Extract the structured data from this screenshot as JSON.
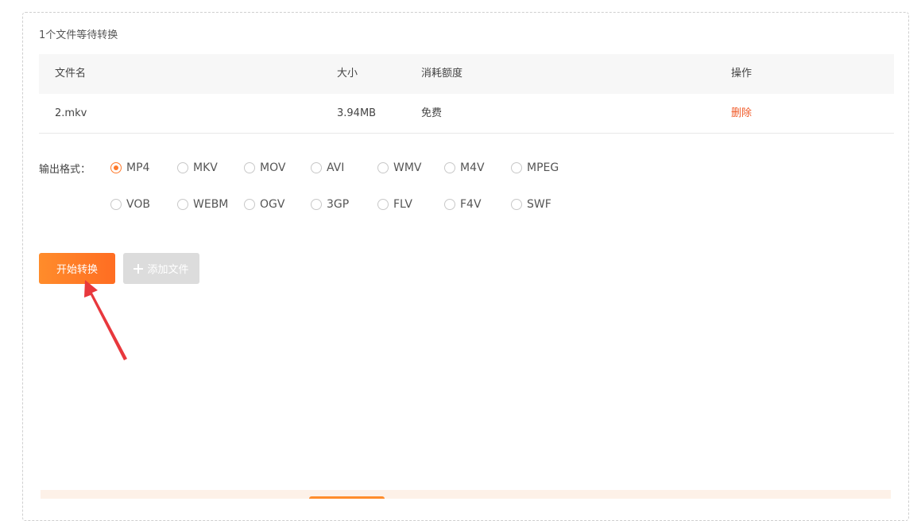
{
  "queue": {
    "title": "1个文件等待转换"
  },
  "table": {
    "headers": {
      "name": "文件名",
      "size": "大小",
      "cost": "消耗额度",
      "action": "操作"
    },
    "rows": [
      {
        "name": "2.mkv",
        "size": "3.94MB",
        "cost": "免费",
        "action": "删除"
      }
    ]
  },
  "output": {
    "label": "输出格式：",
    "selected": "MP4",
    "formats": [
      "MP4",
      "MKV",
      "MOV",
      "AVI",
      "WMV",
      "M4V",
      "MPEG",
      "VOB",
      "WEBM",
      "OGV",
      "3GP",
      "FLV",
      "F4V",
      "SWF"
    ]
  },
  "buttons": {
    "start": "开始转换",
    "add": "添加文件"
  },
  "colors": {
    "accent": "#ff7a2b",
    "delete": "#f05a28",
    "arrow": "#e8383d"
  },
  "icons": {
    "add": "plus-icon",
    "annotation": "red-arrow-annotation"
  }
}
